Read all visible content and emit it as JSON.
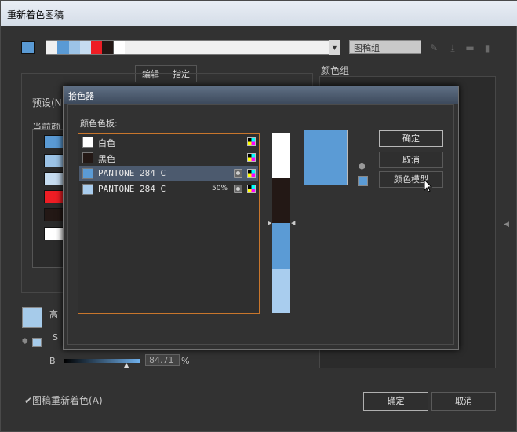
{
  "window": {
    "title": "重新着色图稿"
  },
  "toolbar": {
    "group_name": "图稿组",
    "colors": [
      "#5a9ad4",
      "#9cc3e6",
      "#c6dcf0",
      "#ee1d24",
      "#231815",
      "#ffffff"
    ],
    "icons": [
      "eyedropper-icon",
      "save-icon",
      "folder-icon",
      "trash-icon"
    ]
  },
  "tabs": [
    {
      "label": "编辑"
    },
    {
      "label": "指定"
    }
  ],
  "left": {
    "preset_label": "预设(N",
    "current_label": "当前颜",
    "current_colors": [
      "#5a9ad4",
      "#9cc3e6",
      "#c6dcf0",
      "#ee1d24",
      "#231815",
      "#ffffff"
    ]
  },
  "right": {
    "group_label": "颜色组"
  },
  "hsb": {
    "h": "高",
    "s": "S",
    "b": "B",
    "b_value": "84.71",
    "b_unit": "%"
  },
  "footer": {
    "recolor": "✔图稿重新着色(A)",
    "ok": "确定",
    "cancel": "取消"
  },
  "picker": {
    "title": "拾色器",
    "swatches_label": "颜色色板:",
    "rows": [
      {
        "name": "白色",
        "color": "#ffffff",
        "tint": "",
        "spot": false
      },
      {
        "name": "黑色",
        "color": "#231815",
        "tint": "",
        "spot": false
      },
      {
        "name": "PANTONE 284 C",
        "color": "#5b9bd5",
        "tint": "",
        "spot": true
      },
      {
        "name": "PANTONE 284 C",
        "color": "#a9cdee",
        "tint": "50%",
        "spot": true
      }
    ],
    "tint_bar": [
      "#ffffff",
      "#231815",
      "#5b9bd5",
      "#a9cdee"
    ],
    "preview_color": "#5b9bd5",
    "buttons": {
      "ok": "确定",
      "cancel": "取消",
      "model": "颜色模型"
    }
  }
}
